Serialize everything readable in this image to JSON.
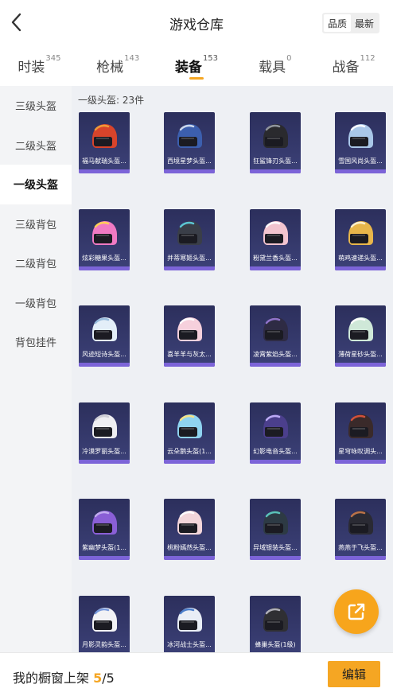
{
  "header": {
    "title": "游戏仓库",
    "back_icon": "chevron-left-icon"
  },
  "sort": {
    "options": [
      "品质",
      "最新"
    ],
    "active": 0
  },
  "tabs": [
    {
      "label": "时装",
      "count": "345"
    },
    {
      "label": "枪械",
      "count": "143"
    },
    {
      "label": "装备",
      "count": "153",
      "active": true
    },
    {
      "label": "载具",
      "count": "0"
    },
    {
      "label": "战备",
      "count": "112"
    }
  ],
  "sidebar": {
    "items": [
      {
        "label": "三级头盔"
      },
      {
        "label": "二级头盔"
      },
      {
        "label": "一级头盔",
        "active": true
      },
      {
        "label": "三级背包"
      },
      {
        "label": "二级背包"
      },
      {
        "label": "一级背包"
      },
      {
        "label": "背包挂件"
      }
    ]
  },
  "content": {
    "section_title": "一级头盔: 23件",
    "items": [
      {
        "name": "福马献瑞头盔...",
        "color": "#d8442b",
        "accent": "#f2a33a"
      },
      {
        "name": "西境星梦头盔...",
        "color": "#3c5fae",
        "accent": "#d9e3f2"
      },
      {
        "name": "狂鲨锋刃头盔...",
        "color": "#2a2a2e",
        "accent": "#9aa0a8"
      },
      {
        "name": "雪国风尚头盔...",
        "color": "#a9c7e8",
        "accent": "#ffffff"
      },
      {
        "name": "炫彩糖果头盔...",
        "color": "#f07ac3",
        "accent": "#ffd84a"
      },
      {
        "name": "并蒂寒姬头盔...",
        "color": "#3a3e48",
        "accent": "#5fd3e0"
      },
      {
        "name": "粉黛兰香头盔...",
        "color": "#f2c4cf",
        "accent": "#ffffff"
      },
      {
        "name": "萌鸡速递头盔...",
        "color": "#e8b64a",
        "accent": "#fff4d6"
      },
      {
        "name": "风迹短诗头盔...",
        "color": "#e3eef8",
        "accent": "#8fb6d9"
      },
      {
        "name": "喜羊羊与灰太...",
        "color": "#f6d0dc",
        "accent": "#ffffff"
      },
      {
        "name": "凌霄紫焰头盔...",
        "color": "#2e2b44",
        "accent": "#9a7bd8"
      },
      {
        "name": "薄荷星砂头盔...",
        "color": "#cfe8d8",
        "accent": "#ffffff"
      },
      {
        "name": "冷漠罗丽头盔...",
        "color": "#eeeef2",
        "accent": "#c9c9d2"
      },
      {
        "name": "云朵鹅头盔(1...",
        "color": "#8fd3f0",
        "accent": "#ffe27a"
      },
      {
        "name": "幻影电音头盔...",
        "color": "#4b3f8c",
        "accent": "#c8b6ff"
      },
      {
        "name": "星穹咏叹调头...",
        "color": "#3a2a2a",
        "accent": "#e2553c"
      },
      {
        "name": "紫幽梦头盔(1...",
        "color": "#8a5fd6",
        "accent": "#c7b3f2"
      },
      {
        "name": "桃粉嫣然头盔...",
        "color": "#f3d6da",
        "accent": "#ffffff"
      },
      {
        "name": "异域银装头盔...",
        "color": "#2d3a44",
        "accent": "#5fd0c7"
      },
      {
        "name": "燕燕于飞头盔...",
        "color": "#2a2a33",
        "accent": "#c97a4a"
      },
      {
        "name": "月影灵韵头盔...",
        "color": "#f2f2f5",
        "accent": "#6a8fd8"
      },
      {
        "name": "冰河战士头盔...",
        "color": "#e9eef6",
        "accent": "#3b72c6"
      },
      {
        "name": "蜂巢头盔(1级)",
        "color": "#2f2f33",
        "accent": "#bfbfc7"
      }
    ]
  },
  "fab": {
    "icon": "external-link-icon"
  },
  "footer": {
    "label": "我的橱窗上架",
    "used": "5",
    "total": "/5",
    "edit_label": "编辑"
  },
  "colors": {
    "accent": "#f5a623",
    "card_bg": "#2c2f5c",
    "card_bar": "#7c64d8"
  }
}
